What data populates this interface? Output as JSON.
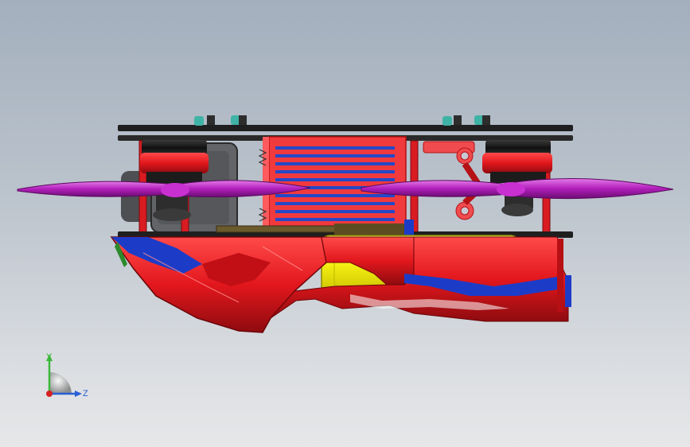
{
  "viewport": {
    "background_top": "#a3afbd",
    "background_bottom": "#e6e7e9",
    "model": "drone-side-view"
  },
  "colors": {
    "frame_red": "#e8242a",
    "frame_dark_red": "#9e0d12",
    "plate_black": "#222222",
    "propeller_purple": "#b020b8",
    "propeller_light": "#e070e8",
    "battery_yellow": "#f2ef1a",
    "canopy_blue": "#1c3cc8",
    "motor_black": "#1e1e1e",
    "nut_teal": "#3aa59a",
    "camera_gray": "#5a5c5e",
    "rod_brown": "#6b5a2c"
  },
  "triad": {
    "y_label": "Y",
    "z_label": "Z",
    "y_color": "#3cb83c",
    "z_color": "#2a5fd4",
    "x_color": "#d62020"
  }
}
